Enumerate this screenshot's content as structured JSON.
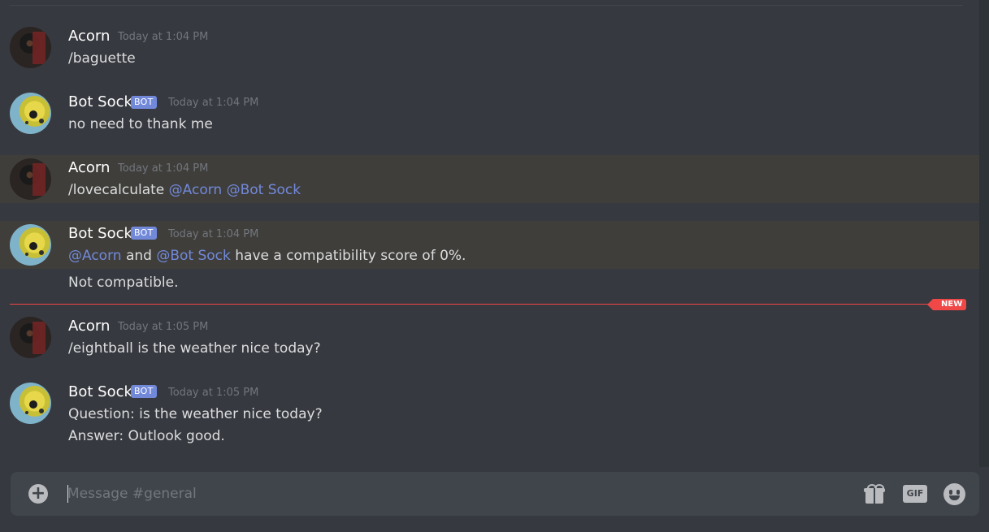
{
  "new_marker": "NEW",
  "messages": [
    {
      "username": "Acorn",
      "timestamp": "Today at 1:04 PM",
      "text": "/baguette"
    },
    {
      "username": "Bot Sock",
      "bot_tag": "BOT",
      "timestamp": "Today at 1:04 PM",
      "text": "no need to thank me"
    },
    {
      "username": "Acorn",
      "timestamp": "Today at 1:04 PM",
      "prefix": "/lovecalculate ",
      "mention1": "@Acorn",
      "mention2": "@Bot Sock"
    },
    {
      "username": "Bot Sock",
      "bot_tag": "BOT",
      "timestamp": "Today at 1:04 PM",
      "mention1": "@Acorn",
      "joiner": " and ",
      "mention2": "@Bot Sock",
      "suffix": " have a compatibility score of 0%.",
      "line2": "Not compatible."
    },
    {
      "username": "Acorn",
      "timestamp": "Today at 1:05 PM",
      "text": "/eightball is the weather nice today?"
    },
    {
      "username": "Bot Sock",
      "bot_tag": "BOT",
      "timestamp": "Today at 1:05 PM",
      "line1": "Question: is the weather nice today?",
      "line2": "Answer: Outlook good."
    }
  ],
  "composer": {
    "placeholder": "Message #general",
    "gif_label": "GIF",
    "icons": [
      "add-icon",
      "gift-icon",
      "gif-icon",
      "emoji-icon"
    ]
  },
  "colors": {
    "background": "#36393f",
    "highlight": "#3f3e3b",
    "mention": "#7289da",
    "new_divider": "#f04747",
    "bot_tag": "#7289da"
  }
}
